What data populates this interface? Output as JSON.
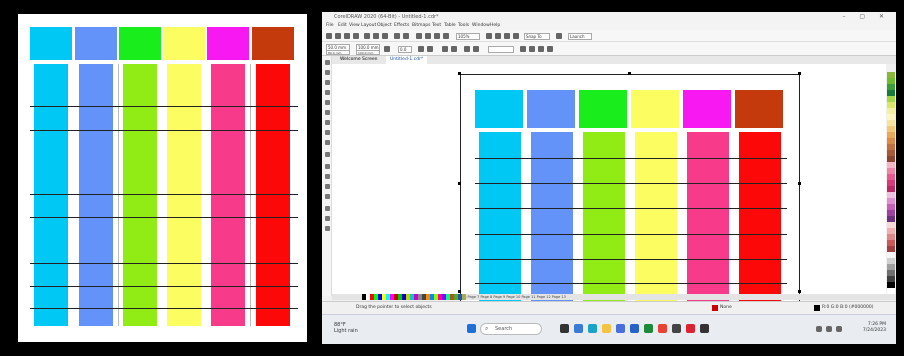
{
  "colors": {
    "cyan": "#00c8f5",
    "blue": "#6392f8",
    "green": "#19ee1c",
    "lime": "#90ec14",
    "yellow": "#fcfd61",
    "magenta": "#f818f2",
    "pink": "#f73b8a",
    "brown": "#c53a0c",
    "red": "#fd0808"
  },
  "window": {
    "title": "CorelDRAW 2020 (64-Bit) - Untitled-1.cdr*",
    "controls": "–  ▢  ✕"
  },
  "menu": [
    "File",
    "Edit",
    "View",
    "Layout",
    "Object",
    "Effects",
    "Bitmaps",
    "Text",
    "Table",
    "Tools",
    "Window",
    "Help"
  ],
  "toolbar": {
    "zoom": "105%",
    "snap_label": "Snap To",
    "launch_label": "Launch"
  },
  "property_bar": {
    "x": "50.0 mm",
    "y": "80.0 mm",
    "w": "100.0 mm",
    "h": "100.0 mm",
    "angle": "0.0"
  },
  "doc_tabs": [
    {
      "label": "Welcome Screen"
    },
    {
      "label": "Untitled-1.cdr*"
    }
  ],
  "page_tabs": "Page 1  Page 2  Page 3  Page 4  Page 5  Page 6  Page 7  Page 8  Page 9  Page 10  Page 11  Page 12  Page 13",
  "status": {
    "hint": "Drag the pointer to select objects",
    "fill_label": "None",
    "outline_label": "R:0 G:0 B:0 (#000000)"
  },
  "taskbar": {
    "weather_temp": "88°F",
    "weather_desc": "Light rain",
    "search_placeholder": "Search",
    "time": "7:26 PM",
    "date": "7/24/2023"
  }
}
